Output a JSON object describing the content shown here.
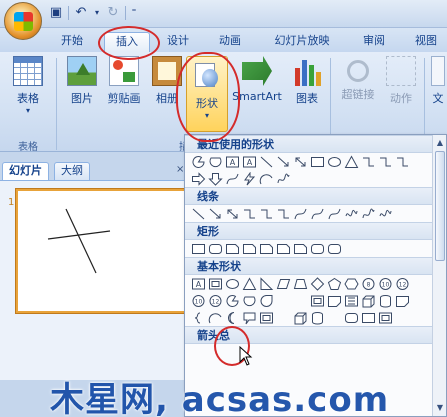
{
  "tabs": [
    "开始",
    "插入",
    "设计",
    "动画",
    "幻灯片放映",
    "审阅",
    "视图"
  ],
  "active_tab": "插入",
  "ribbon": {
    "table_group": {
      "button": "表格",
      "label": "表格"
    },
    "illustrations": {
      "picture": "图片",
      "clipart": "剪贴画",
      "album": "相册",
      "shapes": "形状",
      "smartart": "SmartArt",
      "chart": "图表",
      "label_fragment": "插"
    },
    "links": {
      "hyperlink": "超链接",
      "action": "动作"
    },
    "text_fragment": "文"
  },
  "slide_pane": {
    "tabs": [
      "幻灯片",
      "大纲"
    ],
    "slide_number": "1"
  },
  "shapes_gallery": {
    "recent": "最近使用的形状",
    "lines": "线条",
    "rectangles": "矩形",
    "basic": "基本形状",
    "arrows_fragment": "箭头总"
  },
  "watermark": "木星网,  acsas.com",
  "colors": {
    "highlight": "#d42b2b",
    "accent": "#15428b"
  }
}
